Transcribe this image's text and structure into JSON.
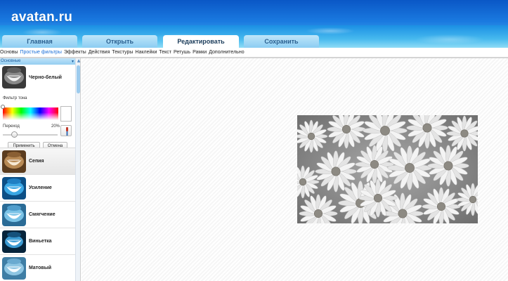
{
  "app": {
    "logo": "avatan.ru"
  },
  "tabs": [
    {
      "label": "Главная"
    },
    {
      "label": "Открыть"
    },
    {
      "label": "Редактировать"
    },
    {
      "label": "Сохранить"
    }
  ],
  "submenu": [
    "Основы",
    "Простые фильтры",
    "Эффекты",
    "Действия",
    "Текстуры",
    "Наклейки",
    "Текст",
    "Ретушь",
    "Рамки",
    "Дополнительно"
  ],
  "panel": {
    "category": "Основные",
    "bw": {
      "label": "Черно-белый",
      "tone_label": "Фильтр тона",
      "transition_label": "Переход",
      "transition_value": "20%",
      "transition_level": 0.2,
      "apply": "Применить",
      "cancel": "Отмена"
    },
    "filters": [
      {
        "label": "Сепия",
        "thumb": "sepia"
      },
      {
        "label": "Усиление",
        "thumb": "blue"
      },
      {
        "label": "Смягчение",
        "thumb": "blue-soft"
      },
      {
        "label": "Виньетка",
        "thumb": "blue-vignette"
      },
      {
        "label": "Матовый",
        "thumb": "blue-matte"
      }
    ]
  },
  "colors": {
    "accent": "#1a6ed8",
    "banner": "#1a7ae0"
  }
}
